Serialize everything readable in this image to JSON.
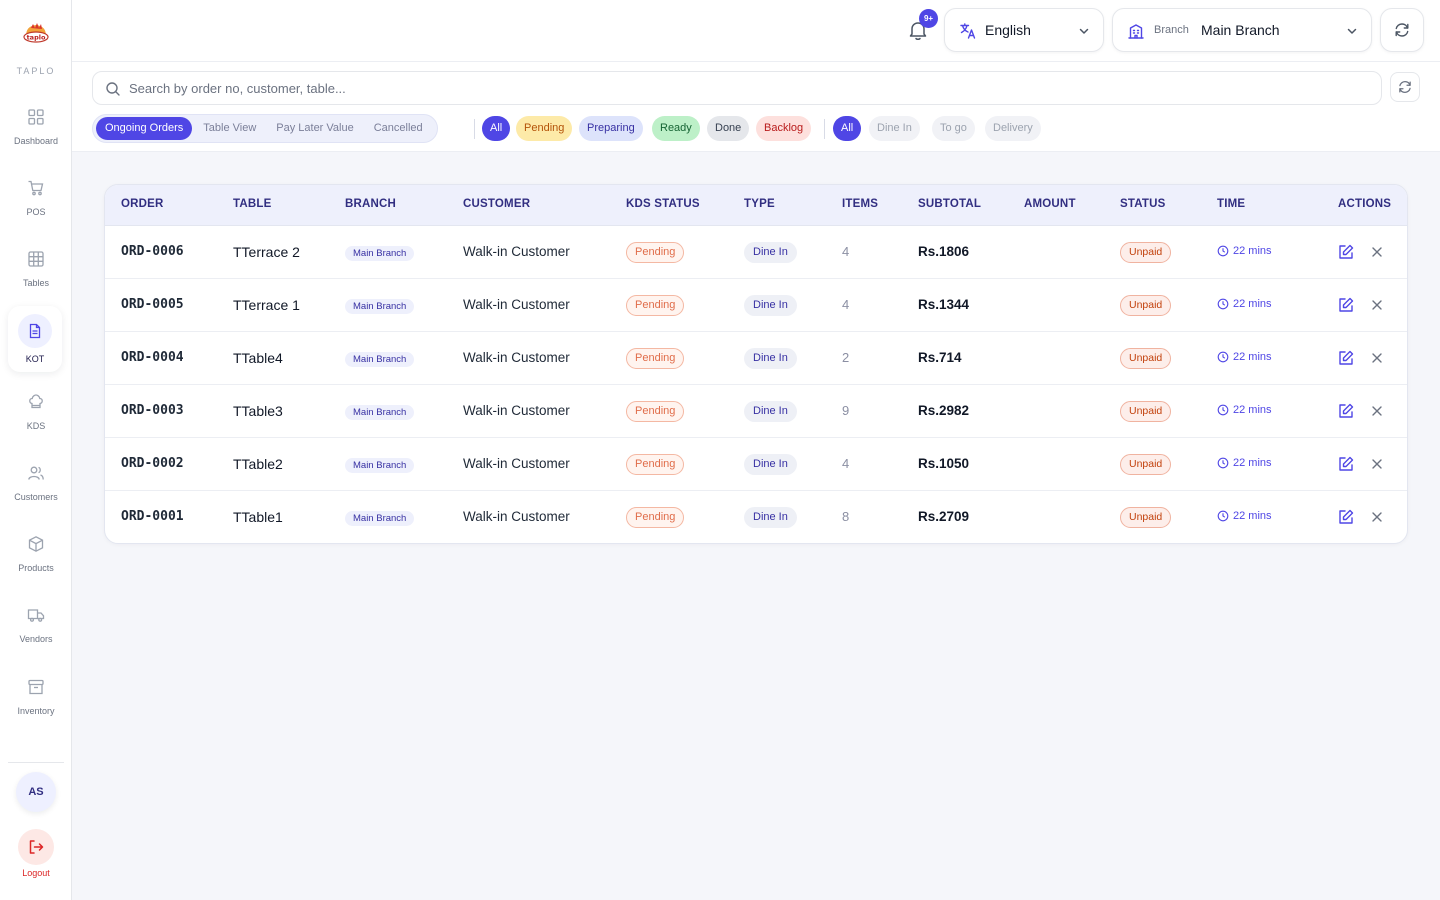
{
  "sidebar": {
    "brand": "TAPLO",
    "items": [
      {
        "label": "Dashboard"
      },
      {
        "label": "POS"
      },
      {
        "label": "Tables"
      },
      {
        "label": "KOT"
      },
      {
        "label": "KDS"
      },
      {
        "label": "Customers"
      },
      {
        "label": "Products"
      },
      {
        "label": "Vendors"
      },
      {
        "label": "Inventory"
      }
    ],
    "active_item": "KOT",
    "avatar_initials": "AS",
    "logout_label": "Logout"
  },
  "header": {
    "notification_badge": "9+",
    "language": {
      "value": "English",
      "icon": "translate-icon"
    },
    "branch": {
      "caption": "Branch",
      "value": "Main Branch",
      "icon": "building-icon"
    }
  },
  "toolbar": {
    "search": {
      "placeholder": "Search by order no, customer, table..."
    },
    "view_tabs": [
      "Ongoing Orders",
      "Table View",
      "Pay Later Value",
      "Cancelled"
    ],
    "active_view_tab": "Ongoing Orders",
    "status_filters": [
      "All",
      "Pending",
      "Preparing",
      "Ready",
      "Done",
      "Backlog"
    ],
    "active_status_filter": "All",
    "type_filters": [
      "All",
      "Dine In",
      "To go",
      "Delivery"
    ],
    "active_type_filter": "All"
  },
  "colors": {
    "accent": "#4f46e5",
    "pending": "#fdeaa8",
    "preparing": "#dde3fb",
    "ready": "#bdf0c8",
    "done": "#e5e7eb",
    "backlog": "#fde0dd"
  },
  "table": {
    "columns": [
      "ORDER",
      "TABLE",
      "BRANCH",
      "CUSTOMER",
      "KDS STATUS",
      "TYPE",
      "ITEMS",
      "SUBTOTAL",
      "AMOUNT",
      "STATUS",
      "TIME",
      "ACTIONS"
    ],
    "rows": [
      {
        "order": "ORD-0006",
        "table": "TTerrace 2",
        "branch": "Main Branch",
        "customer": "Walk-in Customer",
        "kds_status": "Pending",
        "type": "Dine In",
        "items": "4",
        "subtotal": "Rs.1806",
        "amount": "",
        "status": "Unpaid",
        "time": "22 mins"
      },
      {
        "order": "ORD-0005",
        "table": "TTerrace 1",
        "branch": "Main Branch",
        "customer": "Walk-in Customer",
        "kds_status": "Pending",
        "type": "Dine In",
        "items": "4",
        "subtotal": "Rs.1344",
        "amount": "",
        "status": "Unpaid",
        "time": "22 mins"
      },
      {
        "order": "ORD-0004",
        "table": "TTable4",
        "branch": "Main Branch",
        "customer": "Walk-in Customer",
        "kds_status": "Pending",
        "type": "Dine In",
        "items": "2",
        "subtotal": "Rs.714",
        "amount": "",
        "status": "Unpaid",
        "time": "22 mins"
      },
      {
        "order": "ORD-0003",
        "table": "TTable3",
        "branch": "Main Branch",
        "customer": "Walk-in Customer",
        "kds_status": "Pending",
        "type": "Dine In",
        "items": "9",
        "subtotal": "Rs.2982",
        "amount": "",
        "status": "Unpaid",
        "time": "22 mins"
      },
      {
        "order": "ORD-0002",
        "table": "TTable2",
        "branch": "Main Branch",
        "customer": "Walk-in Customer",
        "kds_status": "Pending",
        "type": "Dine In",
        "items": "4",
        "subtotal": "Rs.1050",
        "amount": "",
        "status": "Unpaid",
        "time": "22 mins"
      },
      {
        "order": "ORD-0001",
        "table": "TTable1",
        "branch": "Main Branch",
        "customer": "Walk-in Customer",
        "kds_status": "Pending",
        "type": "Dine In",
        "items": "8",
        "subtotal": "Rs.2709",
        "amount": "",
        "status": "Unpaid",
        "time": "22 mins"
      }
    ]
  }
}
